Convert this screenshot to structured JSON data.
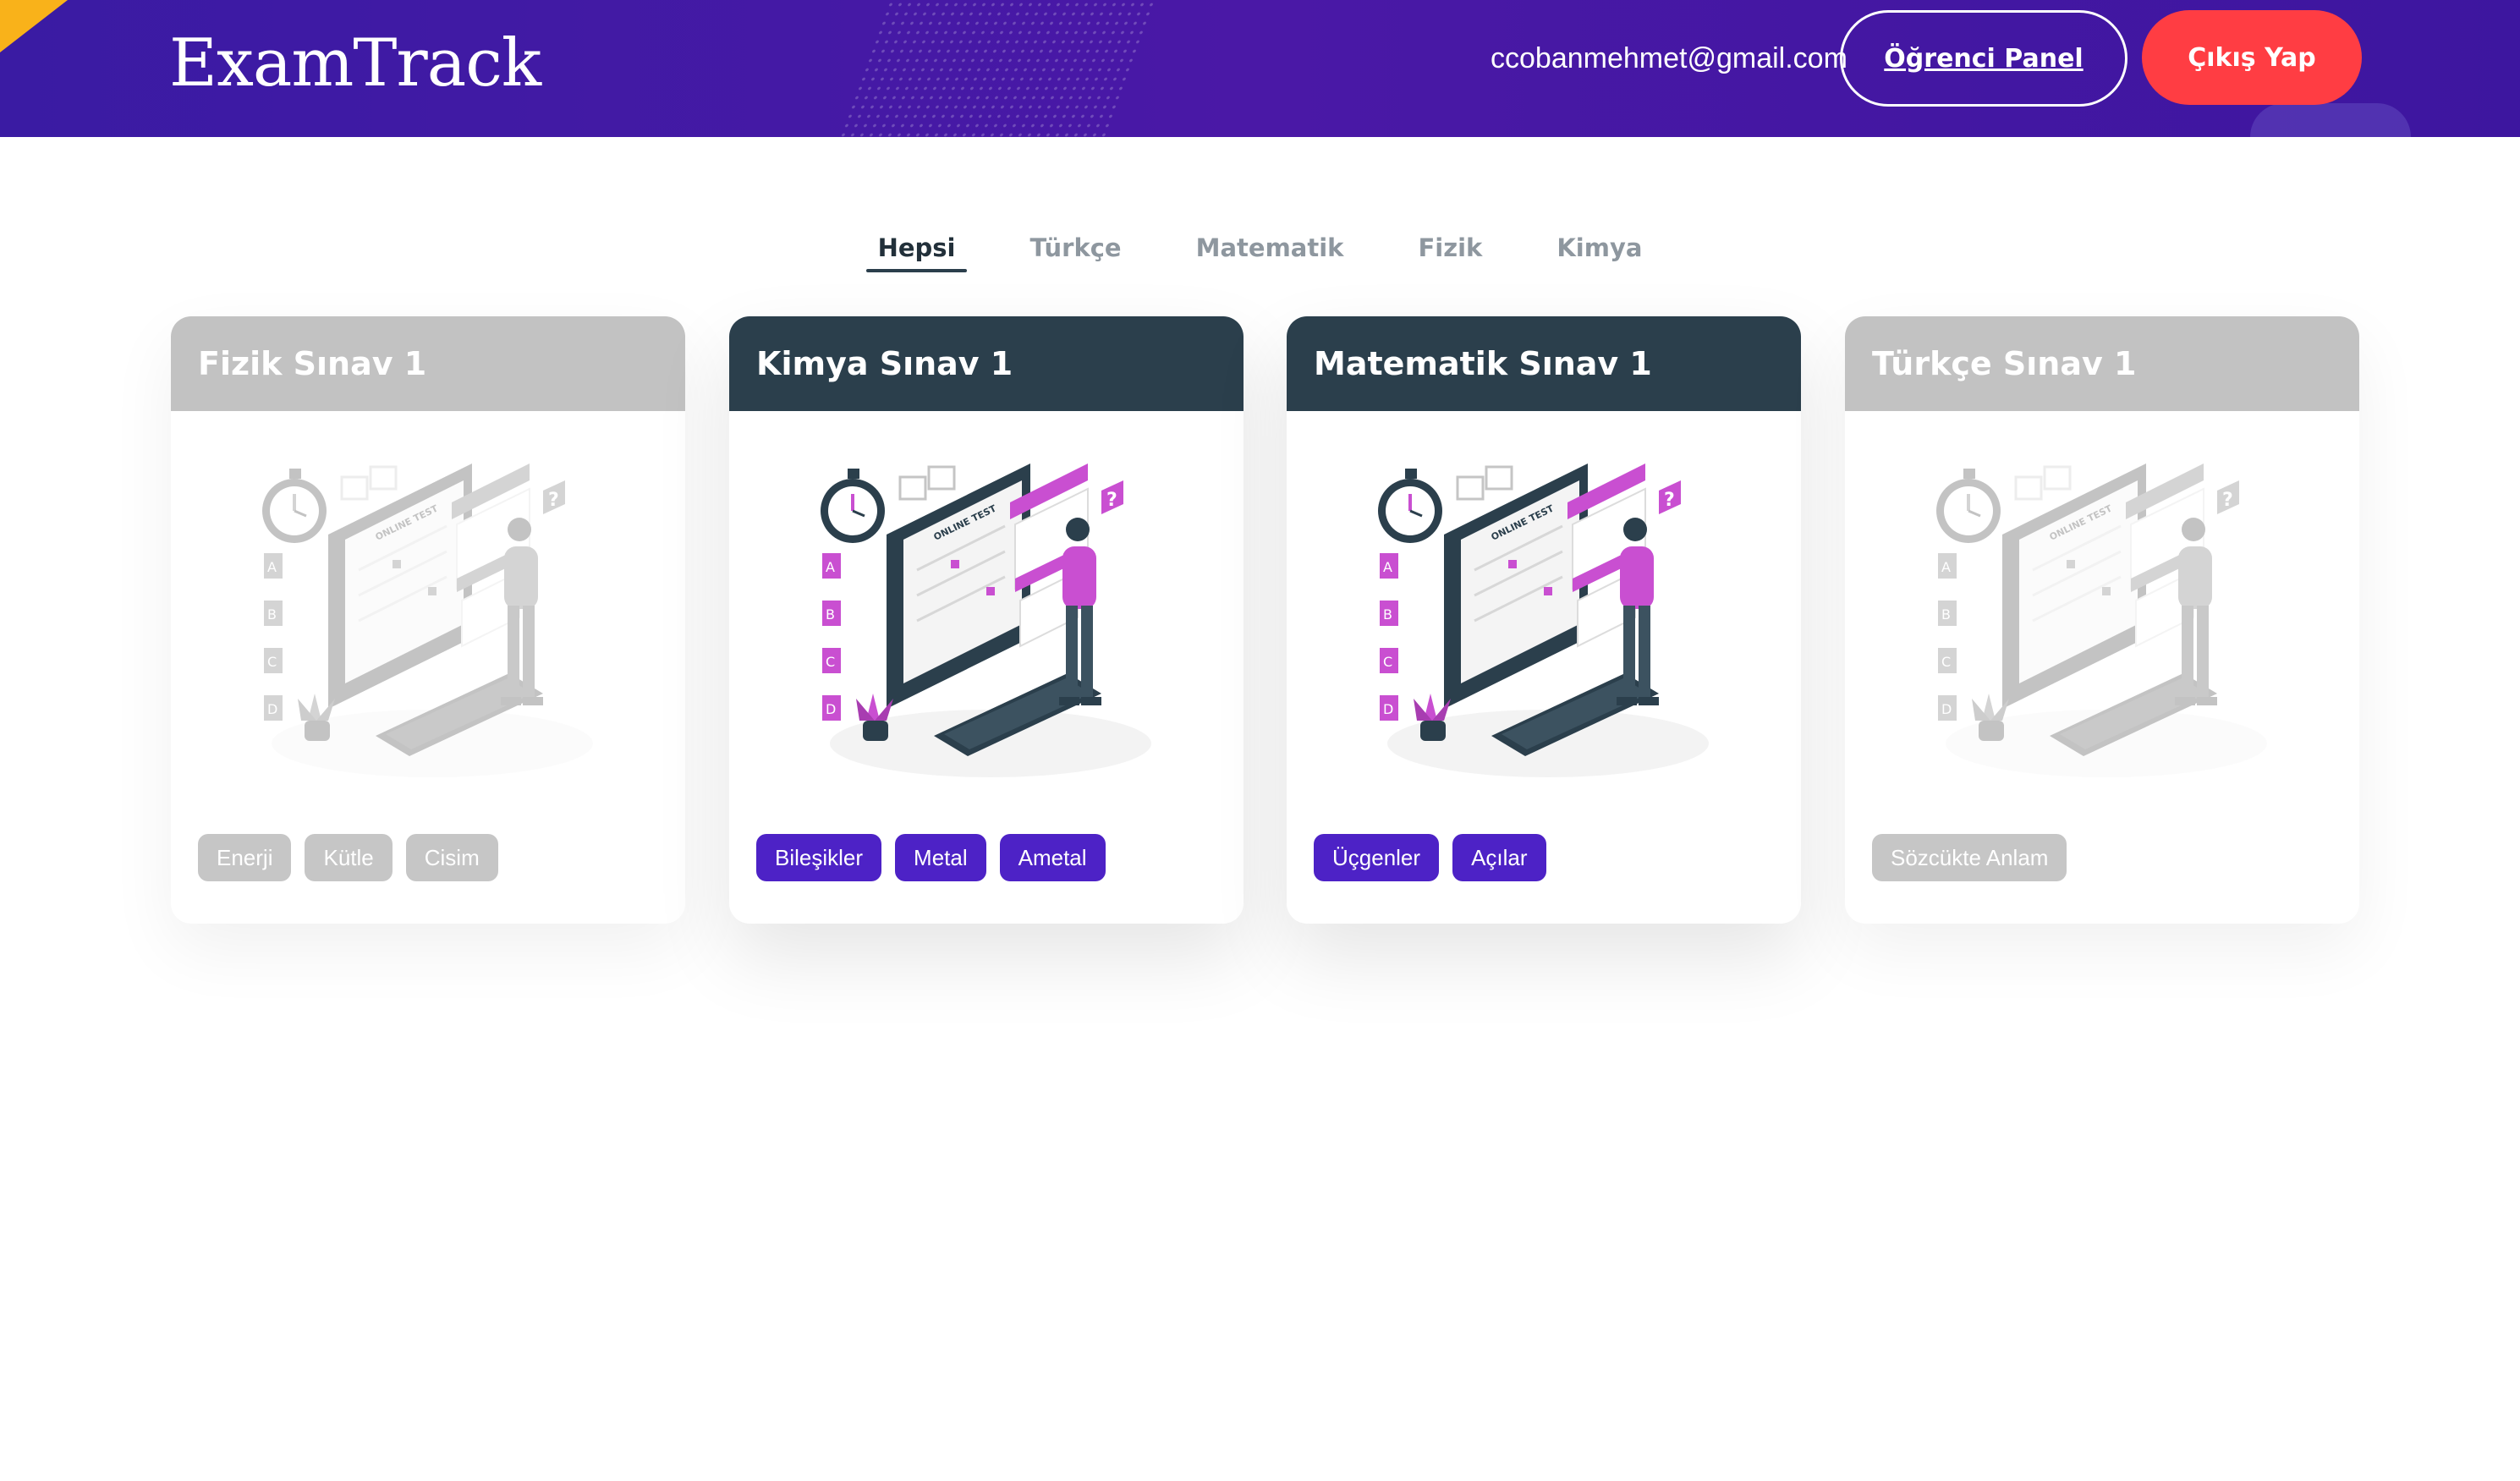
{
  "header": {
    "logo": "ExamTrack",
    "email": "ccobanmehmet@gmail.com",
    "panel_button": "Öğrenci Panel",
    "logout_button": "Çıkış Yap"
  },
  "tabs": [
    {
      "label": "Hepsi",
      "active": true
    },
    {
      "label": "Türkçe",
      "active": false
    },
    {
      "label": "Matematik",
      "active": false
    },
    {
      "label": "Fizik",
      "active": false
    },
    {
      "label": "Kimya",
      "active": false
    }
  ],
  "cards": [
    {
      "title": "Fizik Sınav 1",
      "active": false,
      "tags": [
        "Enerji",
        "Kütle",
        "Cisim"
      ],
      "illustration_text": "ONLINE TEST"
    },
    {
      "title": "Kimya Sınav 1",
      "active": true,
      "tags": [
        "Bileşikler",
        "Metal",
        "Ametal"
      ],
      "illustration_text": "ONLINE TEST"
    },
    {
      "title": "Matematik Sınav 1",
      "active": true,
      "tags": [
        "Üçgenler",
        "Açılar"
      ],
      "illustration_text": "ONLINE TEST"
    },
    {
      "title": "Türkçe Sınav 1",
      "active": false,
      "tags": [
        "Sözcükte Anlam"
      ],
      "illustration_text": "ONLINE TEST"
    }
  ],
  "illustration": {
    "answer_letters": [
      "A",
      "B",
      "C",
      "D"
    ],
    "question_mark": "?"
  },
  "colors": {
    "header_bg": "#4a18a6",
    "logout_bg": "#ff3d43",
    "card_head_active": "#2b3f4c",
    "card_head_inactive": "#c2c2c2",
    "tag_active": "#4d22c6",
    "tag_inactive": "#c6c6c6",
    "accent_pink": "#c94fd1"
  },
  "icons": [
    "stopwatch-icon",
    "computer-monitor-icon",
    "keyboard-icon",
    "plant-icon",
    "question-mark-icon",
    "student-figure-icon"
  ]
}
